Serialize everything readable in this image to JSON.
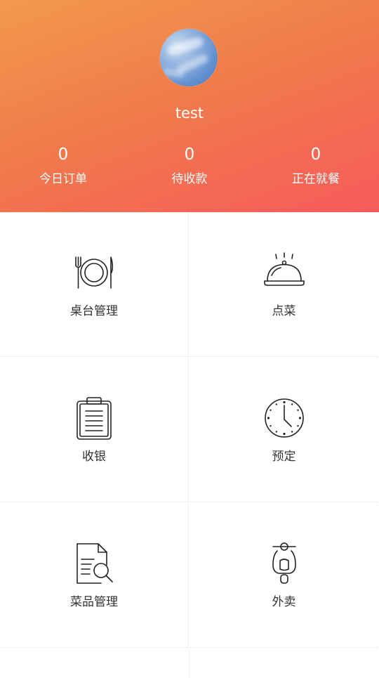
{
  "profile": {
    "username": "test",
    "avatar_icon": "sky-avatar"
  },
  "stats": [
    {
      "value": "0",
      "label": "今日订单"
    },
    {
      "value": "0",
      "label": "待收款"
    },
    {
      "value": "0",
      "label": "正在就餐"
    }
  ],
  "menu": [
    {
      "label": "桌台管理",
      "icon": "plate-cutlery-icon"
    },
    {
      "label": "点菜",
      "icon": "serving-cloche-icon"
    },
    {
      "label": "收银",
      "icon": "clipboard-icon"
    },
    {
      "label": "预定",
      "icon": "clock-icon"
    },
    {
      "label": "菜品管理",
      "icon": "document-search-icon"
    },
    {
      "label": "外卖",
      "icon": "scooter-icon"
    }
  ],
  "colors": {
    "header_gradient_start": "#f2994e",
    "header_gradient_end": "#f65b5c",
    "label_text": "#333333",
    "divider": "#eeeeee"
  }
}
